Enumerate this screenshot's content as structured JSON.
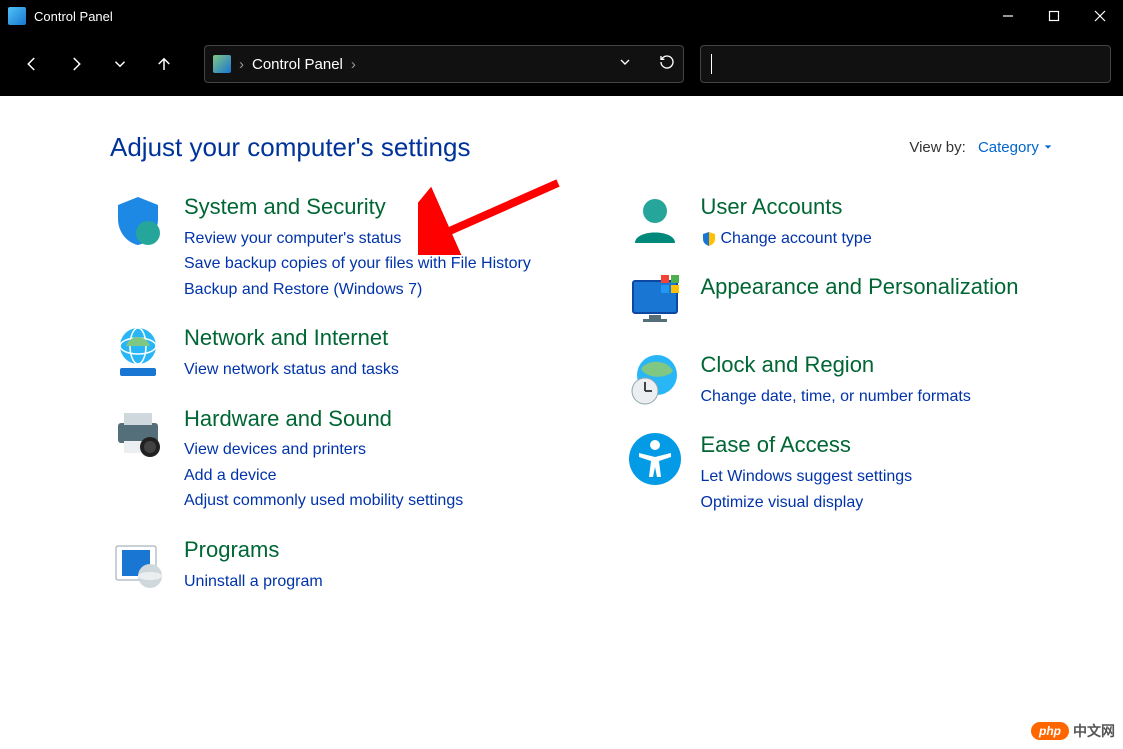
{
  "window": {
    "title": "Control Panel"
  },
  "breadcrumb": {
    "root": "Control Panel"
  },
  "header": {
    "title": "Adjust your computer's settings",
    "view_by_label": "View by:",
    "view_by_value": "Category"
  },
  "categories": {
    "system_security": {
      "title": "System and Security",
      "links": [
        "Review your computer's status",
        "Save backup copies of your files with File History",
        "Backup and Restore (Windows 7)"
      ]
    },
    "network": {
      "title": "Network and Internet",
      "links": [
        "View network status and tasks"
      ]
    },
    "hardware": {
      "title": "Hardware and Sound",
      "links": [
        "View devices and printers",
        "Add a device",
        "Adjust commonly used mobility settings"
      ]
    },
    "programs": {
      "title": "Programs",
      "links": [
        "Uninstall a program"
      ]
    },
    "user_accounts": {
      "title": "User Accounts",
      "links": [
        "Change account type"
      ]
    },
    "appearance": {
      "title": "Appearance and Personalization",
      "links": []
    },
    "clock": {
      "title": "Clock and Region",
      "links": [
        "Change date, time, or number formats"
      ]
    },
    "ease": {
      "title": "Ease of Access",
      "links": [
        "Let Windows suggest settings",
        "Optimize visual display"
      ]
    }
  },
  "watermark": {
    "badge": "php",
    "text": "中文网"
  }
}
